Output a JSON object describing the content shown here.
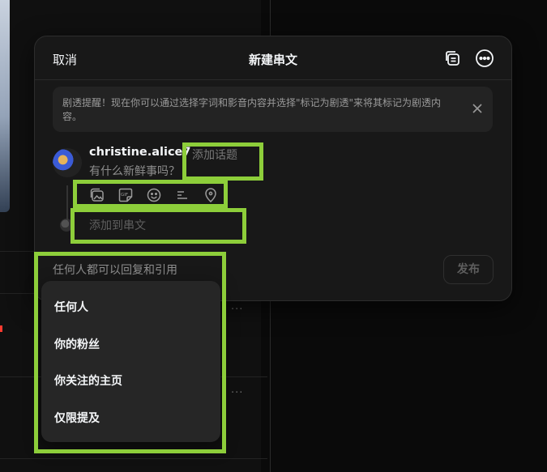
{
  "modal": {
    "cancel_label": "取消",
    "title": "新建串文",
    "header_icons": [
      "drafts-icon",
      "more-options-icon"
    ]
  },
  "spoiler": {
    "text": "剧透提醒！现在你可以通过选择字词和影音内容并选择\"标记为剧透\"来将其标记为剧透内容。",
    "close_icon": "close-icon"
  },
  "composer": {
    "username": "christine.alice7",
    "add_topic": "添加话题",
    "placeholder": "有什么新鲜事吗？",
    "attachment_icons": [
      "image-icon",
      "gif-icon",
      "emoji-icon",
      "list-icon",
      "location-icon"
    ],
    "add_to_thread": "添加到串文",
    "publish_label": "发布"
  },
  "audience": {
    "selected": "任何人都可以回复和引用",
    "options": [
      "任何人",
      "你的粉丝",
      "你关注的主页",
      "仅限提及"
    ]
  },
  "colors": {
    "highlight": "#8dce3a",
    "modal_bg": "#181818",
    "menu_bg": "#262626"
  }
}
